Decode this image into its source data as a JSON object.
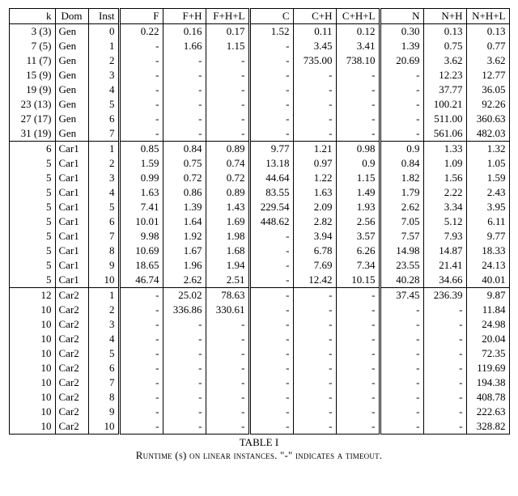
{
  "headers": {
    "k": "k",
    "dom": "Dom",
    "inst": "Inst",
    "F": "F",
    "FH": "F+H",
    "FHL": "F+H+L",
    "C": "C",
    "CH": "C+H",
    "CHL": "C+H+L",
    "N": "N",
    "NH": "N+H",
    "NHL": "N+H+L"
  },
  "caption_line1": "TABLE I",
  "caption_line2": "Runtime (s) on linear instances. \"-\" indicates a timeout.",
  "groups": [
    {
      "rows": [
        {
          "k": "3 (3)",
          "dom": "Gen",
          "inst": "0",
          "F": "0.22",
          "FH": "0.16",
          "FHL": "0.17",
          "C": "1.52",
          "CH": "0.11",
          "CHL": "0.12",
          "N": "0.30",
          "NH": "0.13",
          "NHL": "0.13"
        },
        {
          "k": "7 (5)",
          "dom": "Gen",
          "inst": "1",
          "F": "-",
          "FH": "1.66",
          "FHL": "1.15",
          "C": "-",
          "CH": "3.45",
          "CHL": "3.41",
          "N": "1.39",
          "NH": "0.75",
          "NHL": "0.77"
        },
        {
          "k": "11 (7)",
          "dom": "Gen",
          "inst": "2",
          "F": "-",
          "FH": "-",
          "FHL": "-",
          "C": "-",
          "CH": "735.00",
          "CHL": "738.10",
          "N": "20.69",
          "NH": "3.62",
          "NHL": "3.62"
        },
        {
          "k": "15 (9)",
          "dom": "Gen",
          "inst": "3",
          "F": "-",
          "FH": "-",
          "FHL": "-",
          "C": "-",
          "CH": "-",
          "CHL": "-",
          "N": "-",
          "NH": "12.23",
          "NHL": "12.77"
        },
        {
          "k": "19 (9)",
          "dom": "Gen",
          "inst": "4",
          "F": "-",
          "FH": "-",
          "FHL": "-",
          "C": "-",
          "CH": "-",
          "CHL": "-",
          "N": "-",
          "NH": "37.77",
          "NHL": "36.05"
        },
        {
          "k": "23 (13)",
          "dom": "Gen",
          "inst": "5",
          "F": "-",
          "FH": "-",
          "FHL": "-",
          "C": "-",
          "CH": "-",
          "CHL": "-",
          "N": "-",
          "NH": "100.21",
          "NHL": "92.26"
        },
        {
          "k": "27 (17)",
          "dom": "Gen",
          "inst": "6",
          "F": "-",
          "FH": "-",
          "FHL": "-",
          "C": "-",
          "CH": "-",
          "CHL": "-",
          "N": "-",
          "NH": "511.00",
          "NHL": "360.63"
        },
        {
          "k": "31 (19)",
          "dom": "Gen",
          "inst": "7",
          "F": "-",
          "FH": "-",
          "FHL": "-",
          "C": "-",
          "CH": "-",
          "CHL": "-",
          "N": "-",
          "NH": "561.06",
          "NHL": "482.03"
        }
      ]
    },
    {
      "rows": [
        {
          "k": "6",
          "dom": "Car1",
          "inst": "1",
          "F": "0.85",
          "FH": "0.84",
          "FHL": "0.89",
          "C": "9.77",
          "CH": "1.21",
          "CHL": "0.98",
          "N": "0.9",
          "NH": "1.33",
          "NHL": "1.32"
        },
        {
          "k": "5",
          "dom": "Car1",
          "inst": "2",
          "F": "1.59",
          "FH": "0.75",
          "FHL": "0.74",
          "C": "13.18",
          "CH": "0.97",
          "CHL": "0.9",
          "N": "0.84",
          "NH": "1.09",
          "NHL": "1.05"
        },
        {
          "k": "5",
          "dom": "Car1",
          "inst": "3",
          "F": "0.99",
          "FH": "0.72",
          "FHL": "0.72",
          "C": "44.64",
          "CH": "1.22",
          "CHL": "1.15",
          "N": "1.82",
          "NH": "1.56",
          "NHL": "1.59"
        },
        {
          "k": "5",
          "dom": "Car1",
          "inst": "4",
          "F": "1.63",
          "FH": "0.86",
          "FHL": "0.89",
          "C": "83.55",
          "CH": "1.63",
          "CHL": "1.49",
          "N": "1.79",
          "NH": "2.22",
          "NHL": "2.43"
        },
        {
          "k": "5",
          "dom": "Car1",
          "inst": "5",
          "F": "7.41",
          "FH": "1.39",
          "FHL": "1.43",
          "C": "229.54",
          "CH": "2.09",
          "CHL": "1.93",
          "N": "2.62",
          "NH": "3.34",
          "NHL": "3.95"
        },
        {
          "k": "5",
          "dom": "Car1",
          "inst": "6",
          "F": "10.01",
          "FH": "1.64",
          "FHL": "1.69",
          "C": "448.62",
          "CH": "2.82",
          "CHL": "2.56",
          "N": "7.05",
          "NH": "5.12",
          "NHL": "6.11"
        },
        {
          "k": "5",
          "dom": "Car1",
          "inst": "7",
          "F": "9.98",
          "FH": "1.92",
          "FHL": "1.98",
          "C": "-",
          "CH": "3.94",
          "CHL": "3.57",
          "N": "7.57",
          "NH": "7.93",
          "NHL": "9.77"
        },
        {
          "k": "5",
          "dom": "Car1",
          "inst": "8",
          "F": "10.69",
          "FH": "1.67",
          "FHL": "1.68",
          "C": "-",
          "CH": "6.78",
          "CHL": "6.26",
          "N": "14.98",
          "NH": "14.87",
          "NHL": "18.33"
        },
        {
          "k": "5",
          "dom": "Car1",
          "inst": "9",
          "F": "18.65",
          "FH": "1.96",
          "FHL": "1.94",
          "C": "-",
          "CH": "7.69",
          "CHL": "7.34",
          "N": "23.55",
          "NH": "21.41",
          "NHL": "24.13"
        },
        {
          "k": "5",
          "dom": "Car1",
          "inst": "10",
          "F": "46.74",
          "FH": "2.62",
          "FHL": "2.51",
          "C": "-",
          "CH": "12.42",
          "CHL": "10.15",
          "N": "40.28",
          "NH": "34.66",
          "NHL": "40.01"
        }
      ]
    },
    {
      "rows": [
        {
          "k": "12",
          "dom": "Car2",
          "inst": "1",
          "F": "-",
          "FH": "25.02",
          "FHL": "78.63",
          "C": "-",
          "CH": "-",
          "CHL": "-",
          "N": "37.45",
          "NH": "236.39",
          "NHL": "9.87"
        },
        {
          "k": "10",
          "dom": "Car2",
          "inst": "2",
          "F": "-",
          "FH": "336.86",
          "FHL": "330.61",
          "C": "-",
          "CH": "-",
          "CHL": "-",
          "N": "-",
          "NH": "-",
          "NHL": "11.84"
        },
        {
          "k": "10",
          "dom": "Car2",
          "inst": "3",
          "F": "-",
          "FH": "-",
          "FHL": "-",
          "C": "-",
          "CH": "-",
          "CHL": "-",
          "N": "-",
          "NH": "-",
          "NHL": "24.98"
        },
        {
          "k": "10",
          "dom": "Car2",
          "inst": "4",
          "F": "-",
          "FH": "-",
          "FHL": "-",
          "C": "-",
          "CH": "-",
          "CHL": "-",
          "N": "-",
          "NH": "-",
          "NHL": "20.04"
        },
        {
          "k": "10",
          "dom": "Car2",
          "inst": "5",
          "F": "-",
          "FH": "-",
          "FHL": "-",
          "C": "-",
          "CH": "-",
          "CHL": "-",
          "N": "-",
          "NH": "-",
          "NHL": "72.35"
        },
        {
          "k": "10",
          "dom": "Car2",
          "inst": "6",
          "F": "-",
          "FH": "-",
          "FHL": "-",
          "C": "-",
          "CH": "-",
          "CHL": "-",
          "N": "-",
          "NH": "-",
          "NHL": "119.69"
        },
        {
          "k": "10",
          "dom": "Car2",
          "inst": "7",
          "F": "-",
          "FH": "-",
          "FHL": "-",
          "C": "-",
          "CH": "-",
          "CHL": "-",
          "N": "-",
          "NH": "-",
          "NHL": "194.38"
        },
        {
          "k": "10",
          "dom": "Car2",
          "inst": "8",
          "F": "-",
          "FH": "-",
          "FHL": "-",
          "C": "-",
          "CH": "-",
          "CHL": "-",
          "N": "-",
          "NH": "-",
          "NHL": "408.78"
        },
        {
          "k": "10",
          "dom": "Car2",
          "inst": "9",
          "F": "-",
          "FH": "-",
          "FHL": "-",
          "C": "-",
          "CH": "-",
          "CHL": "-",
          "N": "-",
          "NH": "-",
          "NHL": "222.63"
        },
        {
          "k": "10",
          "dom": "Car2",
          "inst": "10",
          "F": "-",
          "FH": "-",
          "FHL": "-",
          "C": "-",
          "CH": "-",
          "CHL": "-",
          "N": "-",
          "NH": "-",
          "NHL": "328.82"
        }
      ]
    }
  ]
}
